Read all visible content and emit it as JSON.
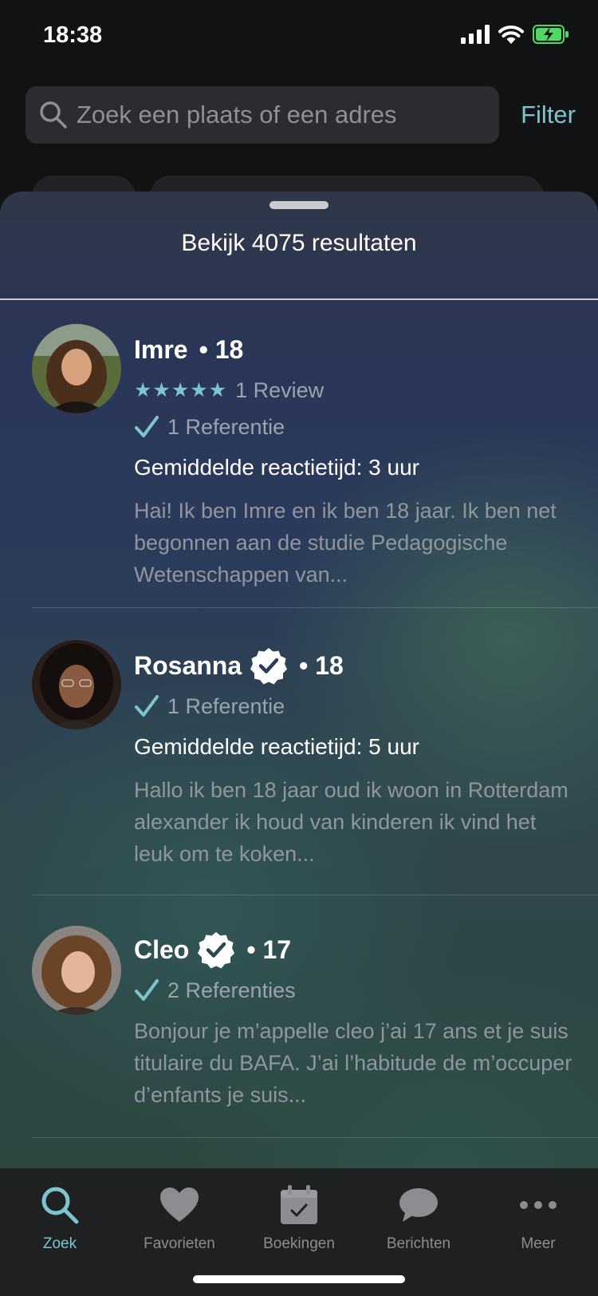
{
  "status": {
    "time": "18:38"
  },
  "search": {
    "placeholder": "Zoek een plaats of een adres",
    "filter_label": "Filter"
  },
  "sheet": {
    "title": "Bekijk 4075 resultaten"
  },
  "profiles": [
    {
      "name": "Imre",
      "verified": false,
      "age": "• 18",
      "stars": "★★★★★",
      "reviews": "1 Review",
      "references": "1 Referentie",
      "response_time": "Gemiddelde reactietijd: 3 uur",
      "description": "Hai! Ik ben Imre en ik ben 18 jaar. Ik ben net begonnen aan de studie Pedagogische Wetenschappen van..."
    },
    {
      "name": "Rosanna",
      "verified": true,
      "age": "• 18",
      "references": "1 Referentie",
      "response_time": "Gemiddelde reactietijd: 5 uur",
      "description": "Hallo ik ben 18 jaar oud ik woon in Rotterdam alexander ik houd van kinderen ik vind het leuk om te koken..."
    },
    {
      "name": "Cleo",
      "verified": true,
      "age": "• 17",
      "references": "2 Referenties",
      "description": "Bonjour je m’appelle cleo j’ai 17 ans et je suis titulaire du BAFA. J’ai l’habitude de m’occuper d’enfants je suis..."
    }
  ],
  "tabbar": {
    "tabs": [
      {
        "label": "Zoek",
        "icon": "search-icon",
        "active": true
      },
      {
        "label": "Favorieten",
        "icon": "heart-icon",
        "active": false
      },
      {
        "label": "Boekingen",
        "icon": "calendar-check-icon",
        "active": false
      },
      {
        "label": "Berichten",
        "icon": "chat-bubble-icon",
        "active": false
      },
      {
        "label": "Meer",
        "icon": "more-dots-icon",
        "active": false
      }
    ]
  },
  "colors": {
    "accent": "#7ec4cf",
    "muted_text": "#8f979e",
    "tab_inactive": "#8b8d91"
  }
}
